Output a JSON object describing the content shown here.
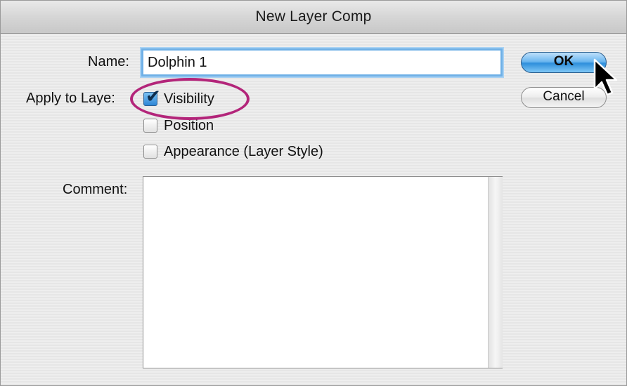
{
  "dialog": {
    "title": "New Layer Comp"
  },
  "form": {
    "name_label": "Name:",
    "name_value": "Dolphin 1",
    "apply_label": "Apply to Laye",
    "apply_label_tail": ":",
    "options": [
      {
        "label": "Visibility",
        "checked": true
      },
      {
        "label": "Position",
        "checked": false
      },
      {
        "label": "Appearance (Layer Style)",
        "checked": false
      }
    ],
    "comment_label": "Comment:",
    "comment_value": ""
  },
  "buttons": {
    "ok_label": "OK",
    "cancel_label": "Cancel"
  },
  "colors": {
    "highlight": "#b3257a",
    "focus_ring": "#6fb0e6",
    "default_button": "#2f8fdc"
  },
  "icons": {
    "pointer": "mouse-pointer-icon",
    "check": "checkmark-icon"
  }
}
